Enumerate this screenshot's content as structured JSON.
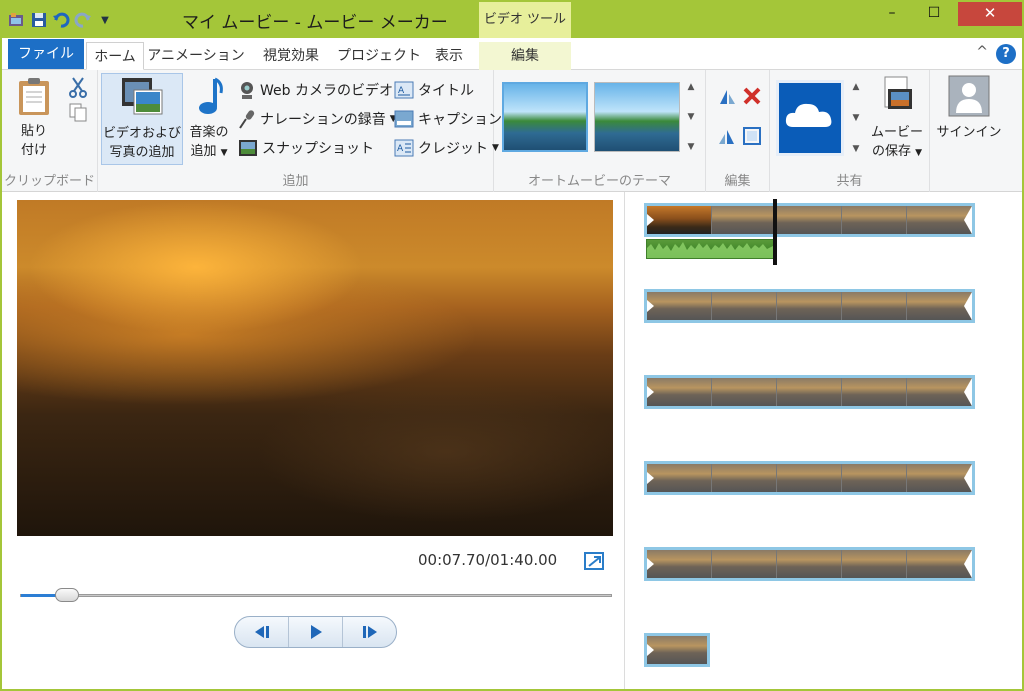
{
  "window": {
    "title": "マイ ムービー - ムービー メーカー",
    "context_tab_group": "ビデオ ツール",
    "accent_color": "#a4c639",
    "controls": {
      "minimize": "–",
      "maximize": "☐",
      "close": "✕"
    }
  },
  "qat": {
    "items": [
      "app-menu-icon",
      "save-icon",
      "undo-icon",
      "redo-icon",
      "customize-dropdown-icon"
    ]
  },
  "tabs": {
    "file": "ファイル",
    "items": [
      "ホーム",
      "アニメーション",
      "視覚効果",
      "プロジェクト",
      "表示"
    ],
    "context_edit": "編集",
    "minimize_ribbon": "^",
    "help": "?"
  },
  "ribbon": {
    "clipboard": {
      "paste": "貼り\n付け",
      "paste_l1": "貼り",
      "paste_l2": "付け",
      "label": "クリップボード"
    },
    "add": {
      "add_video_l1": "ビデオおよび",
      "add_video_l2": "写真の追加",
      "add_music_l1": "音楽の",
      "add_music_l2": "追加",
      "webcam": "Web カメラのビデオ",
      "narration": "ナレーションの録音",
      "snapshot": "スナップショット",
      "title": "タイトル",
      "caption": "キャプション",
      "credits": "クレジット",
      "label": "追加"
    },
    "themes": {
      "label": "オートムービーのテーマ"
    },
    "edit": {
      "label": "編集"
    },
    "share": {
      "save_l1": "ムービー",
      "save_l2": "の保存",
      "label": "共有"
    },
    "signin": "サインイン"
  },
  "player": {
    "time": "00:07.70/01:40.00",
    "progress": 0.077
  },
  "storyboard": {
    "clips": [
      {
        "frames": 5,
        "has_audio": true,
        "selected_first": true
      },
      {
        "frames": 5
      },
      {
        "frames": 5
      },
      {
        "frames": 5
      },
      {
        "frames": 5
      },
      {
        "frames": 1
      }
    ]
  }
}
